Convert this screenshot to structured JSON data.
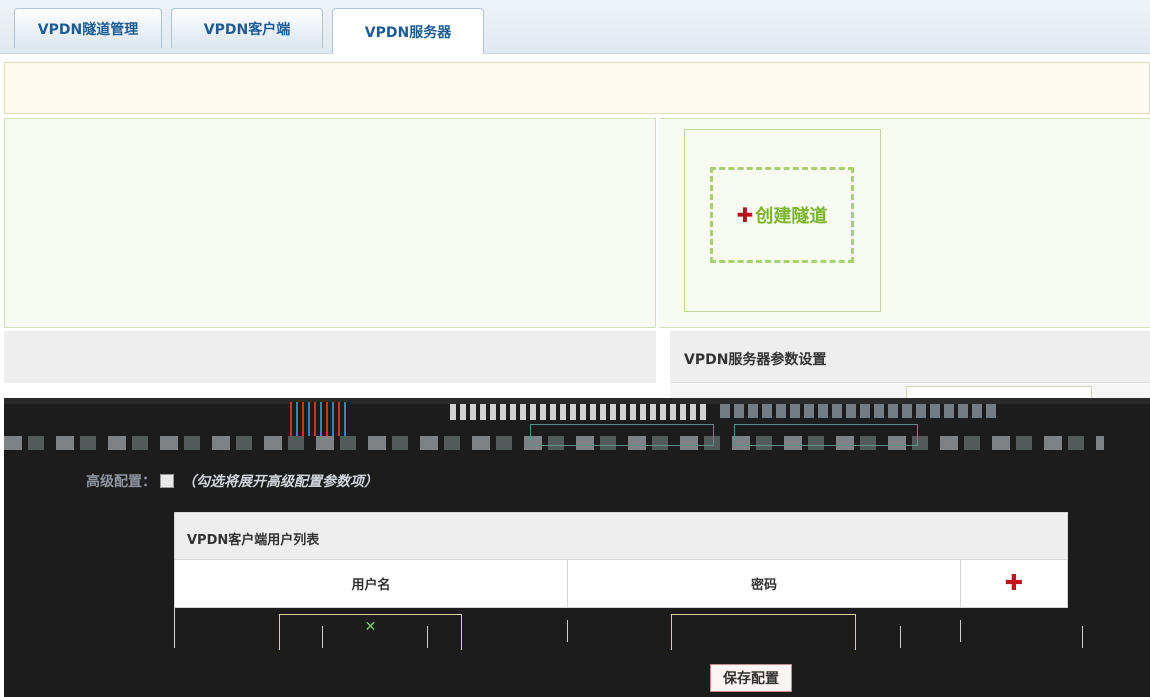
{
  "tabs": [
    {
      "label": "VPDN隧道管理",
      "active": false
    },
    {
      "label": "VPDN客户端",
      "active": false
    },
    {
      "label": "VPDN服务器",
      "active": true
    }
  ],
  "tunnel": {
    "create_label": "创建隧道",
    "plus_glyph": "✚"
  },
  "server_panel": {
    "title": "VPDN服务器参数设置"
  },
  "advanced": {
    "label": "高级配置：",
    "hint": "（勾选将展开高级配置参数项）"
  },
  "user_list": {
    "title": "VPDN客户端用户列表",
    "columns": [
      "用户名",
      "密码"
    ],
    "add_glyph": "✚",
    "row_icon": "✕"
  },
  "buttons": {
    "save": "保存配置"
  },
  "colors": {
    "tab_text": "#1f5c94",
    "create_text": "#7ab52c",
    "add_icon": "#c0141c",
    "dark_zone": "#1c1c1c"
  }
}
